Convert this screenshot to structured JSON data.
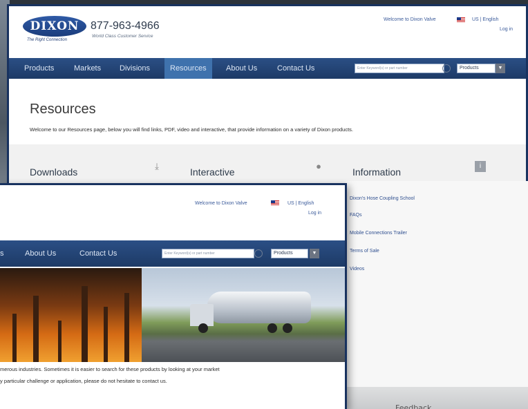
{
  "header": {
    "logo_text": "DIXON",
    "tagline": "The Right Connection",
    "phone": "877-963-4966",
    "service": "World Class Customer Service",
    "welcome": "Welcome to Dixon Valve",
    "language": "US | English",
    "login": "Log in"
  },
  "nav": {
    "items": [
      "Products",
      "Markets",
      "Divisions",
      "Resources",
      "About Us",
      "Contact Us"
    ],
    "active": "Resources",
    "search_placeholder": "Enter Keyword(s) or part number",
    "product_select": "Products"
  },
  "resources_page": {
    "title": "Resources",
    "intro": "Welcome to our Resources page, below you will find links, PDF, video and interactive, that provide information on a variety of Dixon products.",
    "sections": [
      {
        "heading": "Downloads",
        "icon": "download-icon"
      },
      {
        "heading": "Interactive",
        "icon": "globe-icon"
      },
      {
        "heading": "Information",
        "icon": "info-icon"
      }
    ],
    "information_links": [
      "Dixon's Hose Coupling School",
      "FAQs",
      "Mobile Connections Trailer",
      "Terms of Sale",
      "Videos"
    ]
  },
  "markets_page": {
    "welcome": "Welcome to Dixon Valve",
    "language": "US | English",
    "login": "Log in",
    "nav_items": [
      "s",
      "About Us",
      "Contact Us"
    ],
    "search_placeholder": "Enter Keyword(s) or part number",
    "product_select": "Products",
    "body_line1": "merous industries. Sometimes it is easier to search for these products by looking at your market",
    "body_line2": "y particular challenge or application, please do not hesitate to contact us."
  },
  "footer": {
    "feedback": "Feedback"
  },
  "colors": {
    "nav_bg": "#1d3a66",
    "nav_active": "#3f72ad",
    "frame": "#18325f",
    "link": "#2f4f8f"
  }
}
